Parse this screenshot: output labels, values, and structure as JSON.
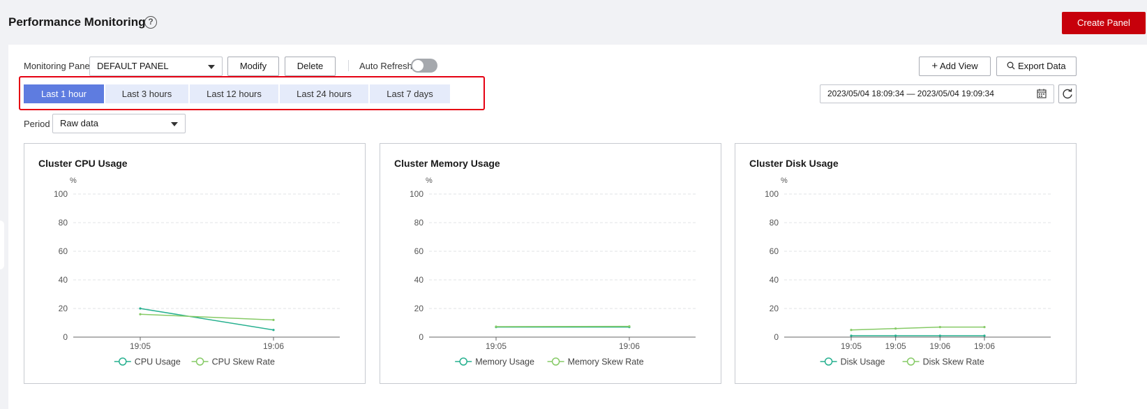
{
  "header": {
    "title": "Performance Monitoring",
    "help_icon": "question-circle-icon",
    "create_label": "Create Panel",
    "accent": "#c7000b"
  },
  "toolbar": {
    "panel_label": "Monitoring Panel",
    "panel_value": "DEFAULT PANEL",
    "modify_label": "Modify",
    "delete_label": "Delete",
    "auto_refresh_label": "Auto Refresh",
    "auto_refresh_on": false,
    "add_view_label": "Add View",
    "export_label": "Export Data",
    "period_label": "Period",
    "period_value": "Raw data"
  },
  "time_ranges": [
    {
      "label": "Last 1 hour",
      "active": true
    },
    {
      "label": "Last 3 hours",
      "active": false
    },
    {
      "label": "Last 12 hours",
      "active": false
    },
    {
      "label": "Last 24 hours",
      "active": false
    },
    {
      "label": "Last 7 days",
      "active": false
    }
  ],
  "date_range": "2023/05/04 18:09:34 — 2023/05/04 19:09:34",
  "chart_data": [
    {
      "type": "line",
      "title": "Cluster CPU Usage",
      "ylabel": "%",
      "ylim": [
        0,
        100
      ],
      "yticks": [
        0,
        20,
        40,
        60,
        80,
        100
      ],
      "x": [
        "19:05",
        "19:06"
      ],
      "grid": true,
      "legend": "bottom",
      "series": [
        {
          "name": "CPU Usage",
          "values": [
            20,
            5
          ],
          "color": "#26b08f"
        },
        {
          "name": "CPU Skew Rate",
          "values": [
            16,
            12
          ],
          "color": "#86ca66"
        }
      ]
    },
    {
      "type": "line",
      "title": "Cluster Memory Usage",
      "ylabel": "%",
      "ylim": [
        0,
        100
      ],
      "yticks": [
        0,
        20,
        40,
        60,
        80,
        100
      ],
      "x": [
        "19:05",
        "19:06"
      ],
      "grid": true,
      "legend": "bottom",
      "series": [
        {
          "name": "Memory Usage",
          "values": [
            7,
            7
          ],
          "color": "#26b08f"
        },
        {
          "name": "Memory Skew Rate",
          "values": [
            7.3,
            7.5
          ],
          "color": "#86ca66"
        }
      ]
    },
    {
      "type": "line",
      "title": "Cluster Disk Usage",
      "ylabel": "%",
      "ylim": [
        0,
        100
      ],
      "yticks": [
        0,
        20,
        40,
        60,
        80,
        100
      ],
      "x": [
        "19:05",
        "19:05",
        "19:06",
        "19:06"
      ],
      "grid": true,
      "legend": "bottom",
      "series": [
        {
          "name": "Disk Usage",
          "values": [
            1,
            1,
            1,
            1
          ],
          "color": "#26b08f"
        },
        {
          "name": "Disk Skew Rate",
          "values": [
            5,
            6,
            7,
            7
          ],
          "color": "#86ca66"
        }
      ]
    }
  ]
}
